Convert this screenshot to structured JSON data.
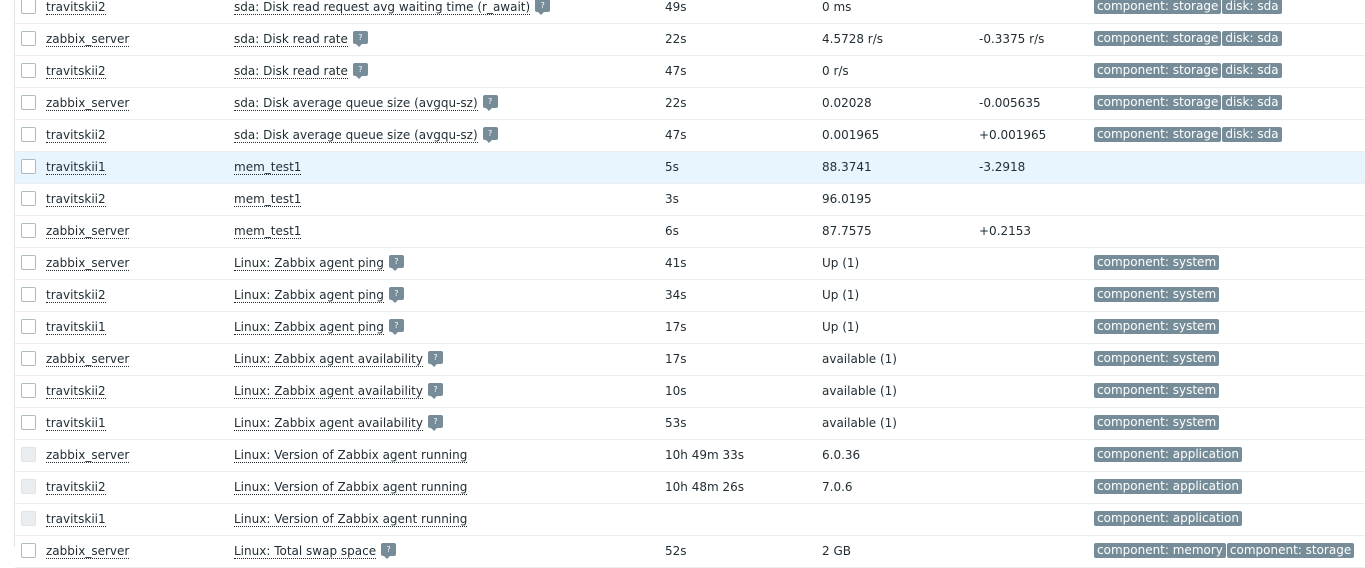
{
  "help_glyph": "?",
  "rows": [
    {
      "host": "travitskii2",
      "name": "sda: Disk read request avg waiting time (r_await)",
      "help": true,
      "interval": "49s",
      "last": "0 ms",
      "change": "",
      "tags": [
        "component: storage",
        "disk: sda"
      ],
      "disabled": false,
      "highlight": false
    },
    {
      "host": "zabbix_server",
      "name": "sda: Disk read rate",
      "help": true,
      "interval": "22s",
      "last": "4.5728 r/s",
      "change": "-0.3375 r/s",
      "tags": [
        "component: storage",
        "disk: sda"
      ],
      "disabled": false,
      "highlight": false
    },
    {
      "host": "travitskii2",
      "name": "sda: Disk read rate",
      "help": true,
      "interval": "47s",
      "last": "0 r/s",
      "change": "",
      "tags": [
        "component: storage",
        "disk: sda"
      ],
      "disabled": false,
      "highlight": false
    },
    {
      "host": "zabbix_server",
      "name": "sda: Disk average queue size (avgqu-sz)",
      "help": true,
      "interval": "22s",
      "last": "0.02028",
      "change": "-0.005635",
      "tags": [
        "component: storage",
        "disk: sda"
      ],
      "disabled": false,
      "highlight": false
    },
    {
      "host": "travitskii2",
      "name": "sda: Disk average queue size (avgqu-sz)",
      "help": true,
      "interval": "47s",
      "last": "0.001965",
      "change": "+0.001965",
      "tags": [
        "component: storage",
        "disk: sda"
      ],
      "disabled": false,
      "highlight": false
    },
    {
      "host": "travitskii1",
      "name": "mem_test1",
      "help": false,
      "interval": "5s",
      "last": "88.3741",
      "change": "-3.2918",
      "tags": [],
      "disabled": false,
      "highlight": true
    },
    {
      "host": "travitskii2",
      "name": "mem_test1",
      "help": false,
      "interval": "3s",
      "last": "96.0195",
      "change": "",
      "tags": [],
      "disabled": false,
      "highlight": false
    },
    {
      "host": "zabbix_server",
      "name": "mem_test1",
      "help": false,
      "interval": "6s",
      "last": "87.7575",
      "change": "+0.2153",
      "tags": [],
      "disabled": false,
      "highlight": false
    },
    {
      "host": "zabbix_server",
      "name": "Linux: Zabbix agent ping",
      "help": true,
      "interval": "41s",
      "last": "Up (1)",
      "change": "",
      "tags": [
        "component: system"
      ],
      "disabled": false,
      "highlight": false
    },
    {
      "host": "travitskii2",
      "name": "Linux: Zabbix agent ping",
      "help": true,
      "interval": "34s",
      "last": "Up (1)",
      "change": "",
      "tags": [
        "component: system"
      ],
      "disabled": false,
      "highlight": false
    },
    {
      "host": "travitskii1",
      "name": "Linux: Zabbix agent ping",
      "help": true,
      "interval": "17s",
      "last": "Up (1)",
      "change": "",
      "tags": [
        "component: system"
      ],
      "disabled": false,
      "highlight": false
    },
    {
      "host": "zabbix_server",
      "name": "Linux: Zabbix agent availability",
      "help": true,
      "interval": "17s",
      "last": "available (1)",
      "change": "",
      "tags": [
        "component: system"
      ],
      "disabled": false,
      "highlight": false
    },
    {
      "host": "travitskii2",
      "name": "Linux: Zabbix agent availability",
      "help": true,
      "interval": "10s",
      "last": "available (1)",
      "change": "",
      "tags": [
        "component: system"
      ],
      "disabled": false,
      "highlight": false
    },
    {
      "host": "travitskii1",
      "name": "Linux: Zabbix agent availability",
      "help": true,
      "interval": "53s",
      "last": "available (1)",
      "change": "",
      "tags": [
        "component: system"
      ],
      "disabled": false,
      "highlight": false
    },
    {
      "host": "zabbix_server",
      "name": "Linux: Version of Zabbix agent running",
      "help": false,
      "interval": "10h 49m 33s",
      "last": "6.0.36",
      "change": "",
      "tags": [
        "component: application"
      ],
      "disabled": true,
      "highlight": false
    },
    {
      "host": "travitskii2",
      "name": "Linux: Version of Zabbix agent running",
      "help": false,
      "interval": "10h 48m 26s",
      "last": "7.0.6",
      "change": "",
      "tags": [
        "component: application"
      ],
      "disabled": true,
      "highlight": false
    },
    {
      "host": "travitskii1",
      "name": "Linux: Version of Zabbix agent running",
      "help": false,
      "interval": "",
      "last": "",
      "change": "",
      "tags": [
        "component: application"
      ],
      "disabled": true,
      "highlight": false
    },
    {
      "host": "zabbix_server",
      "name": "Linux: Total swap space",
      "help": true,
      "interval": "52s",
      "last": "2 GB",
      "change": "",
      "tags": [
        "component: memory",
        "component: storage"
      ],
      "disabled": false,
      "highlight": false
    }
  ]
}
